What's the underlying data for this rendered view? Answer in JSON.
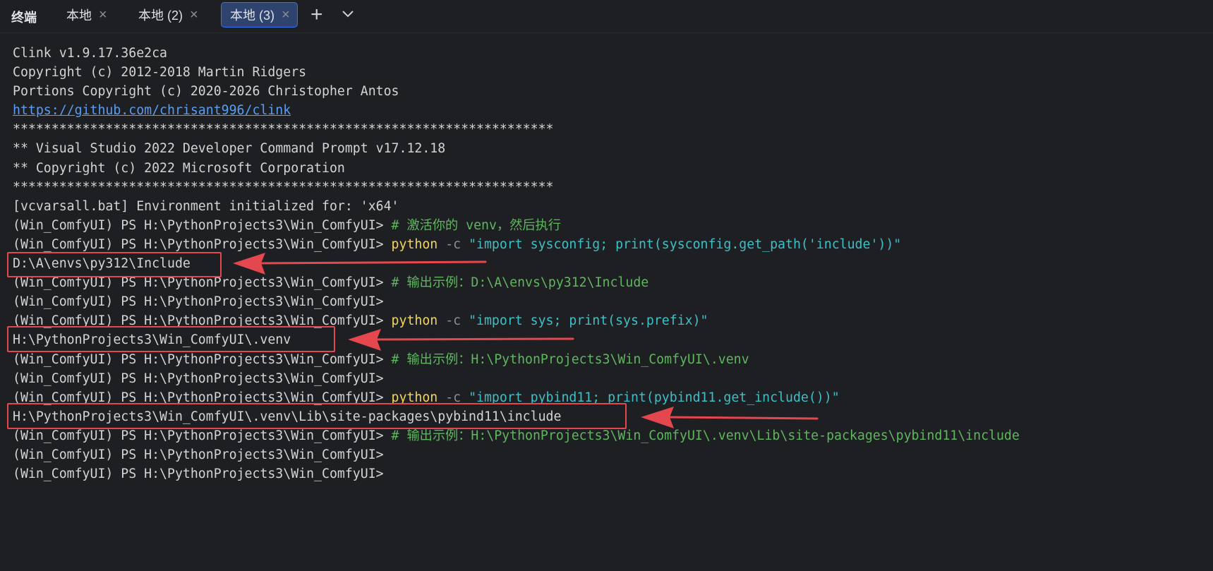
{
  "tool_window": {
    "title": "终端",
    "tabs": [
      {
        "label": "本地",
        "close_glyph": "×"
      },
      {
        "label": "本地 (2)",
        "close_glyph": "×"
      },
      {
        "label": "本地 (3)",
        "close_glyph": "×",
        "active": true
      }
    ],
    "new_tab_glyph": "+",
    "more_icon": "chevron-down-icon"
  },
  "terminal": {
    "prompt": "(Win_ComfyUI) PS H:\\PythonProjects3\\Win_ComfyUI>",
    "banner": [
      "Clink v1.9.17.36e2ca",
      "Copyright (c) 2012-2018 Martin Ridgers",
      "Portions Copyright (c) 2020-2026 Christopher Antos"
    ],
    "link": "https://github.com/chrisant996/clink",
    "stars": "**********************************************************************",
    "vs_line1": "** Visual Studio 2022 Developer Command Prompt v17.12.18",
    "vs_line2": "** Copyright (c) 2022 Microsoft Corporation",
    "env_line": "[vcvarsall.bat] Environment initialized for: 'x64'",
    "comment1": "# 激活你的 venv，然后执行",
    "cmd1": {
      "exe": "python",
      "flag": "-c",
      "arg": "\"import sysconfig; print(sysconfig.get_path('include'))\""
    },
    "out1": "D:\\A\\envs\\py312\\Include",
    "comment2": "# 输出示例：D:\\A\\envs\\py312\\Include",
    "cmd2": {
      "exe": "python",
      "flag": "-c",
      "arg": "\"import sys; print(sys.prefix)\""
    },
    "out2": "H:\\PythonProjects3\\Win_ComfyUI\\.venv",
    "comment3": "# 输出示例：H:\\PythonProjects3\\Win_ComfyUI\\.venv",
    "cmd3": {
      "exe": "python",
      "flag": "-c",
      "arg": "\"import pybind11; print(pybind11.get_include())\""
    },
    "out3": "H:\\PythonProjects3\\Win_ComfyUI\\.venv\\Lib\\site-packages\\pybind11\\include",
    "comment4": "# 输出示例：H:\\PythonProjects3\\Win_ComfyUI\\.venv\\Lib\\site-packages\\pybind11\\include"
  },
  "colors": {
    "background": "#1e1f22",
    "text": "#d4d4d4",
    "link": "#589df6",
    "comment": "#5fb65f",
    "command": "#f2d45c",
    "string": "#3cc0c7",
    "annotation": "#e4474d",
    "active_tab": "#2e436e"
  }
}
